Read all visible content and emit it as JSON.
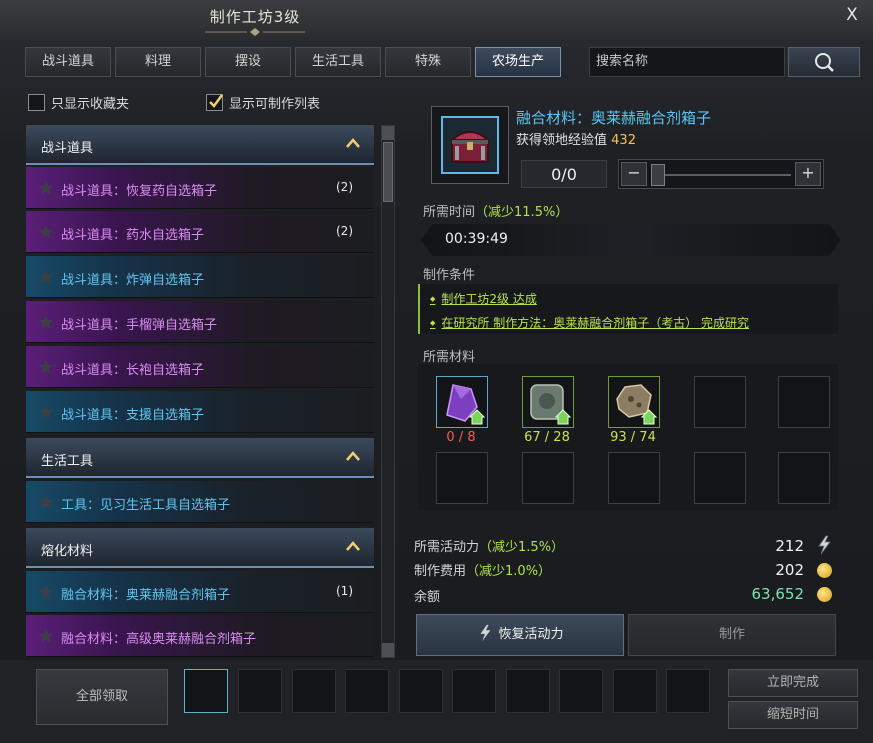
{
  "window": {
    "title": "制作工坊3级",
    "close_label": "X"
  },
  "tabs": [
    {
      "label": "战斗道具",
      "active": false
    },
    {
      "label": "料理",
      "active": false
    },
    {
      "label": "摆设",
      "active": false
    },
    {
      "label": "生活工具",
      "active": false
    },
    {
      "label": "特殊",
      "active": false
    },
    {
      "label": "农场生产",
      "active": true
    }
  ],
  "search": {
    "placeholder": "搜索名称"
  },
  "filters": {
    "favorites_only": {
      "label": "只显示收藏夹",
      "checked": false
    },
    "craftable_only": {
      "label": "显示可制作列表",
      "checked": true
    }
  },
  "list": {
    "categories": [
      {
        "label": "战斗道具",
        "items": [
          {
            "label": "战斗道具：恢复药自选箱子",
            "count": "(2)",
            "grade": "purple"
          },
          {
            "label": "战斗道具：药水自选箱子",
            "count": "(2)",
            "grade": "purple"
          },
          {
            "label": "战斗道具：炸弹自选箱子",
            "count": "",
            "grade": "blue"
          },
          {
            "label": "战斗道具：手榴弹自选箱子",
            "count": "",
            "grade": "purple"
          },
          {
            "label": "战斗道具：长袍自选箱子",
            "count": "",
            "grade": "purple"
          },
          {
            "label": "战斗道具：支援自选箱子",
            "count": "",
            "grade": "blue"
          }
        ]
      },
      {
        "label": "生活工具",
        "items": [
          {
            "label": "工具：见习生活工具自选箱子",
            "count": "",
            "grade": "blue"
          }
        ]
      },
      {
        "label": "熔化材料",
        "items": [
          {
            "label": "融合材料：奥莱赫融合剂箱子",
            "count": "(1)",
            "grade": "blue"
          },
          {
            "label": "融合材料：高级奥莱赫融合剂箱子",
            "count": "",
            "grade": "purple"
          }
        ]
      }
    ]
  },
  "detail": {
    "name": "融合材料：奥莱赫融合剂箱子",
    "exp_label": "获得领地经验值",
    "exp_value": "432",
    "quantity": "0/0",
    "time_label": "所需时间",
    "time_reduction": "（减少11.5%）",
    "time_value": "00:39:49",
    "conditions_label": "制作条件",
    "conditions": [
      "制作工坊2级 达成",
      "在研究所 制作方法：奥莱赫融合剂箱子（考古） 完成研究"
    ],
    "materials_label": "所需材料",
    "materials": [
      {
        "icon": "purple-crystal-icon",
        "count": "0 / 8",
        "status": "insufficient"
      },
      {
        "icon": "stone-relic-icon",
        "count": "67 / 28",
        "status": "enough"
      },
      {
        "icon": "fossil-fragment-icon",
        "count": "93 / 74",
        "status": "enough"
      }
    ],
    "energy_label": "所需活动力",
    "energy_reduction": "（减少1.5%）",
    "energy_value": "212",
    "cost_label": "制作费用",
    "cost_reduction": "（减少1.0%）",
    "cost_value": "202",
    "balance_label": "余额",
    "balance_value": "63,652",
    "recover_button": "恢复活动力",
    "craft_button": "制作"
  },
  "bottom": {
    "claim_all": "全部领取",
    "complete_now": "立即完成",
    "shorten_time": "缩短时间"
  },
  "colors": {
    "purple_grade": "#d98cf0",
    "blue_grade": "#61c4ef",
    "accent_green": "#aee34a",
    "insufficient_red": "#ff5a4a",
    "exp_gold": "#f3c548",
    "balance_green": "#7fe3b0"
  }
}
